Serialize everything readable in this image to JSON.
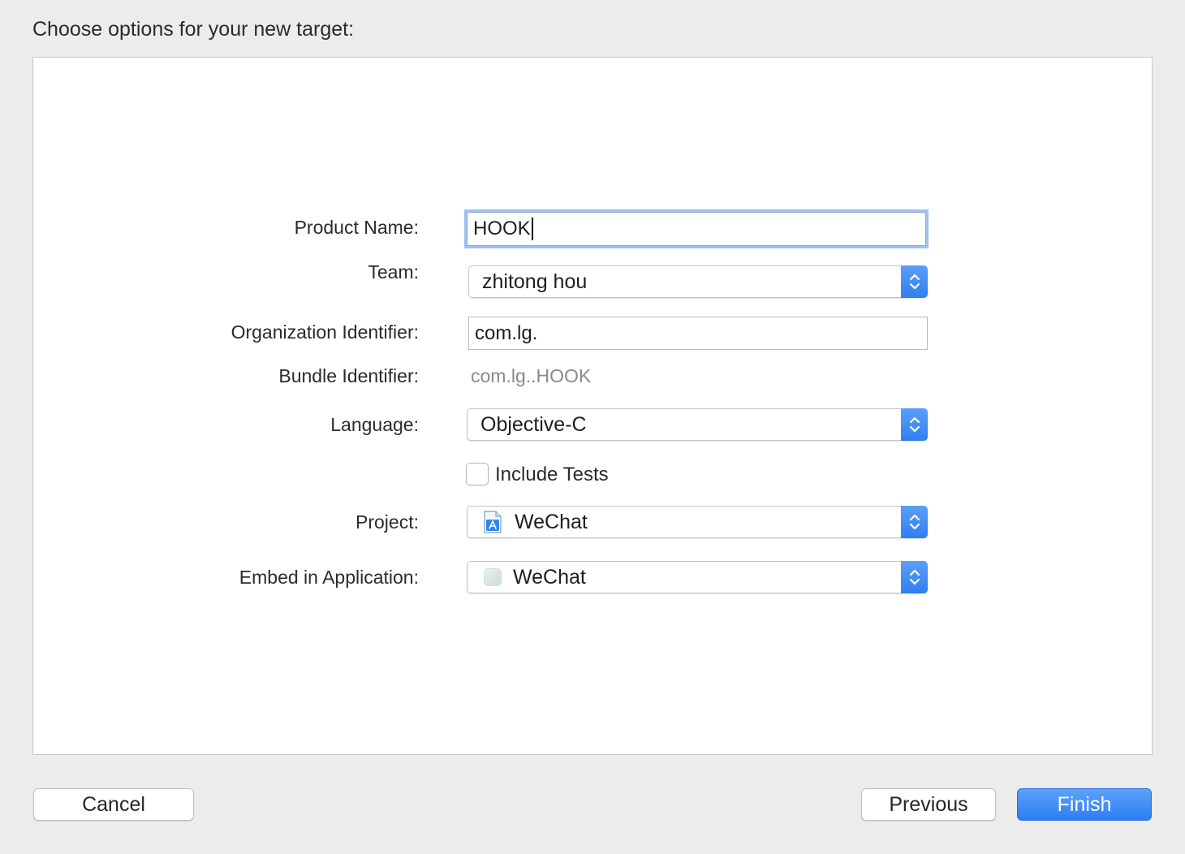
{
  "header": {
    "title": "Choose options for your new target:"
  },
  "form": {
    "product_name": {
      "label": "Product Name:",
      "value": "HOOK"
    },
    "team": {
      "label": "Team:",
      "value": "zhitong hou"
    },
    "organization_identifier": {
      "label": "Organization Identifier:",
      "value": "com.lg."
    },
    "bundle_identifier": {
      "label": "Bundle Identifier:",
      "value": "com.lg..HOOK"
    },
    "language": {
      "label": "Language:",
      "value": "Objective-C"
    },
    "include_tests": {
      "label": "Include Tests",
      "checked": false
    },
    "project": {
      "label": "Project:",
      "value": "WeChat",
      "icon": "xcode-project-icon"
    },
    "embed_in_application": {
      "label": "Embed in Application:",
      "value": "WeChat",
      "icon": "app-icon"
    }
  },
  "footer": {
    "cancel_label": "Cancel",
    "previous_label": "Previous",
    "finish_label": "Finish"
  },
  "colors": {
    "accent": "#2f7ff2",
    "focus_ring": "#9ec1ef",
    "window_bg": "#ececec"
  }
}
